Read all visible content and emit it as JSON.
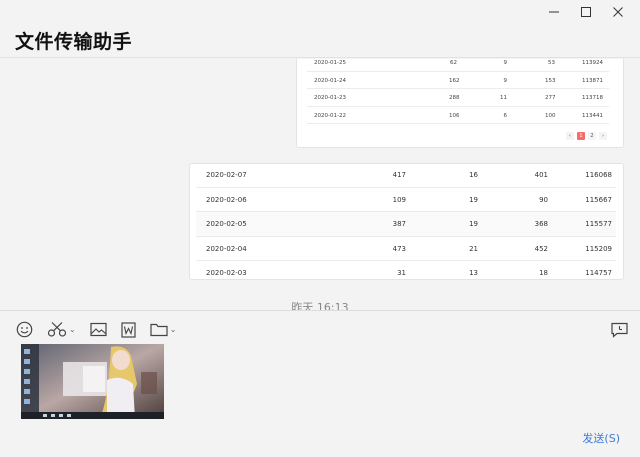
{
  "window": {
    "title": "文件传输助手",
    "minimize_glyph": "—",
    "maximize_glyph": "☐",
    "close_glyph": "✕"
  },
  "table1": {
    "rows": [
      [
        "2020-01-25",
        "62",
        "9",
        "53",
        "113924"
      ],
      [
        "2020-01-24",
        "162",
        "9",
        "153",
        "113871"
      ],
      [
        "2020-01-23",
        "288",
        "11",
        "277",
        "113718"
      ],
      [
        "2020-01-22",
        "106",
        "6",
        "100",
        "113441"
      ]
    ],
    "pagination": {
      "prev": "‹",
      "pages": [
        "1",
        "2"
      ],
      "current": "1",
      "next": "›"
    }
  },
  "table2": {
    "rows": [
      [
        "2020-02-07",
        "417",
        "16",
        "401",
        "116068"
      ],
      [
        "2020-02-06",
        "109",
        "19",
        "90",
        "115667"
      ],
      [
        "2020-02-05",
        "387",
        "19",
        "368",
        "115577"
      ],
      [
        "2020-02-04",
        "473",
        "21",
        "452",
        "115209"
      ],
      [
        "2020-02-03",
        "31",
        "13",
        "18",
        "114757"
      ]
    ]
  },
  "chat": {
    "timestamp": "昨天 16:13"
  },
  "toolbar": {
    "icons": [
      "emoji-icon",
      "scissors-icon",
      "image-icon",
      "word-icon",
      "folder-icon",
      "chat-history-icon"
    ],
    "dropdown_glyph": "⌄"
  },
  "composer": {
    "send_label": "发送(S)",
    "attachment": "screenshot-thumbnail"
  }
}
